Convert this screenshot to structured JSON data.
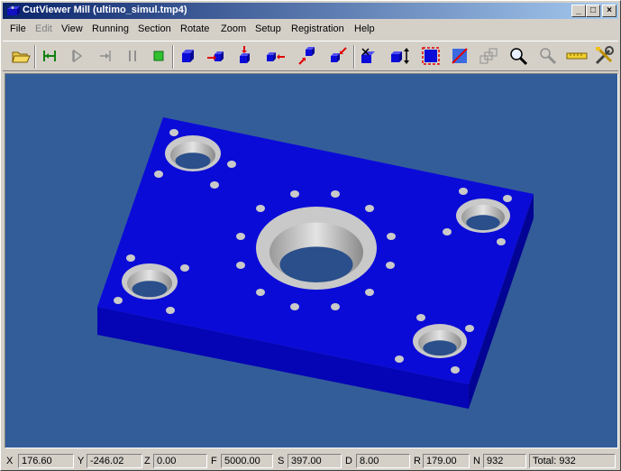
{
  "window": {
    "title": "CutViewer Mill (ultimo_simul.tmp4)"
  },
  "caption_buttons": {
    "minimize": "_",
    "maximize": "□",
    "close": "×"
  },
  "menu": [
    {
      "label": "File",
      "enabled": true
    },
    {
      "label": "Edit",
      "enabled": false
    },
    {
      "label": "View",
      "enabled": true
    },
    {
      "label": "Running",
      "enabled": true
    },
    {
      "label": "Section",
      "enabled": true
    },
    {
      "label": "Rotate",
      "enabled": true
    },
    {
      "label": "Zoom",
      "enabled": true
    },
    {
      "label": "Setup",
      "enabled": true
    },
    {
      "label": "Registration",
      "enabled": true
    },
    {
      "label": "Help",
      "enabled": true
    }
  ],
  "toolbar": [
    {
      "icon": "open-folder-icon"
    },
    {
      "icon": "rewind-icon"
    },
    {
      "icon": "play-icon"
    },
    {
      "icon": "step-icon"
    },
    {
      "icon": "pause-icon"
    },
    {
      "icon": "stop-icon"
    },
    {
      "icon": "view-iso-icon"
    },
    {
      "icon": "view-front-icon"
    },
    {
      "icon": "view-top-icon"
    },
    {
      "icon": "view-right-icon"
    },
    {
      "icon": "view-rotate-iso-icon"
    },
    {
      "icon": "view-rotate-back-icon"
    },
    {
      "icon": "section-x-icon"
    },
    {
      "icon": "section-fit-icon"
    },
    {
      "icon": "zoom-window-icon"
    },
    {
      "icon": "zoom-extents-icon"
    },
    {
      "icon": "zoom-all-icon"
    },
    {
      "icon": "zoom-icon"
    },
    {
      "icon": "measure-icon"
    },
    {
      "icon": "ruler-icon"
    },
    {
      "icon": "tools-icon"
    }
  ],
  "colors": {
    "viewport_bg": "#335d99",
    "part_top": "#0b0bd8",
    "part_front": "#0505b5",
    "part_side": "#040494",
    "hole_gray": "#c9c9c9"
  },
  "status": {
    "x_label": "X",
    "x_value": "176.60",
    "y_label": "Y",
    "y_value": "-246.02",
    "z_label": "Z",
    "z_value": "0.00",
    "f_label": "F",
    "f_value": "5000.00",
    "s_label": "S",
    "s_value": "397.00",
    "d_label": "D",
    "d_value": "8.00",
    "r_label": "R",
    "r_value": "179.00",
    "n_label": "N",
    "n_value": "932",
    "total": "Total: 932"
  }
}
